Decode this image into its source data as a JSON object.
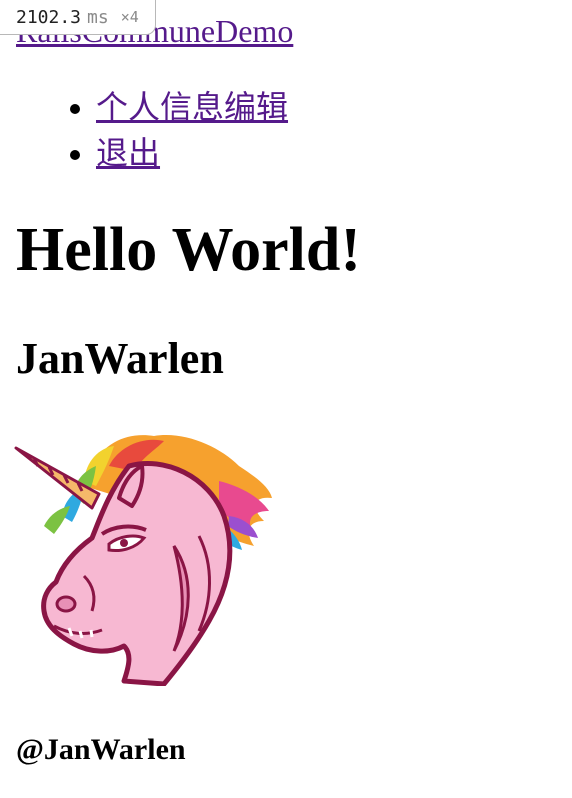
{
  "perf": {
    "value": "2102.3",
    "unit": "ms",
    "count": "×4"
  },
  "header": {
    "site_title": "RailsCommuneDemo"
  },
  "nav": {
    "items": [
      {
        "label": "个人信息编辑"
      },
      {
        "label": "退出"
      }
    ]
  },
  "main": {
    "greeting": "Hello World!",
    "username": "JanWarlen",
    "avatar_icon": "unicorn-avatar-icon",
    "handle": "@JanWarlen"
  },
  "colors": {
    "link": "#551a8b",
    "unicorn_pink": "#f7b8d2",
    "outline": "#8a1545"
  }
}
